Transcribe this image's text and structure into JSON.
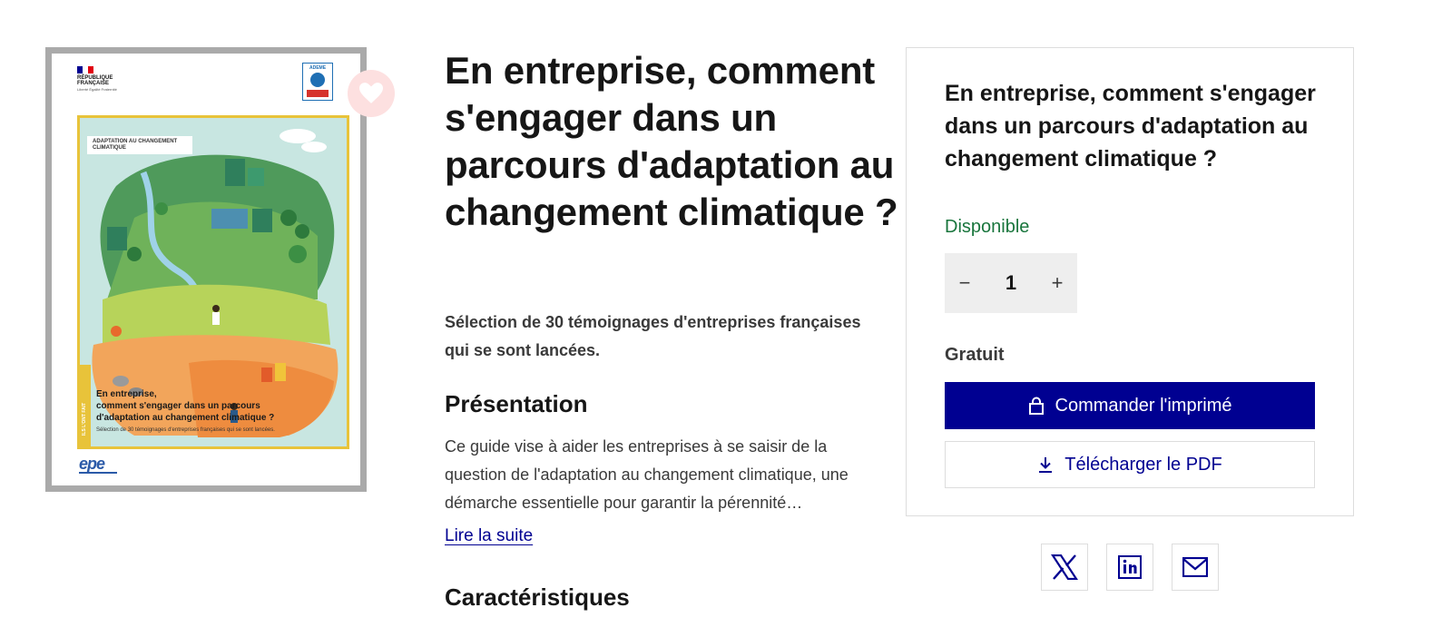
{
  "cover": {
    "republic_label": "RÉPUBLIQUE FRANÇAISE",
    "republic_motto": "Liberté Égalité Fraternité",
    "ademe_label": "ADEME",
    "tag": "ADAPTATION AU CHANGEMENT CLIMATIQUE",
    "side_band": "ILS L'ONT FAIT",
    "title_line1": "En entreprise,",
    "title_line2": "comment s'engager dans un parcours",
    "title_line3": "d'adaptation au changement climatique ?",
    "subtitle": "Sélection de 30 témoignages d'entreprises françaises qui se sont lancées.",
    "publisher_logo": "epe"
  },
  "favorite": {
    "icon": "heart-icon"
  },
  "product": {
    "title": "En entreprise, comment s'engager dans un parcours d'adaptation au changement climatique ?",
    "lead": "Sélection de 30 témoignages d'entreprises françaises qui se sont lancées.",
    "presentation_heading": "Présentation",
    "presentation_text": "Ce guide vise à aider les entreprises à se saisir de la question de l'adaptation au changement climatique, une démarche essentielle pour garantir la pérennité…",
    "read_more": "Lire la suite",
    "features_heading": "Caractéristiques"
  },
  "order": {
    "title": "En entreprise, comment s'engager dans un parcours d'adaptation au changement climatique ?",
    "availability": "Disponible",
    "quantity": "1",
    "decrement_symbol": "−",
    "increment_symbol": "+",
    "price": "Gratuit",
    "order_button": "Commander l'imprimé",
    "download_button": "Télécharger le PDF"
  },
  "share": {
    "icons": [
      "x-twitter-icon",
      "linkedin-icon",
      "mail-icon"
    ]
  },
  "colors": {
    "primary": "#000091",
    "available": "#18753c",
    "favorite_bg": "#fde0e0",
    "favorite_icon": "#ffffff",
    "cover_border": "#aaaaaa"
  }
}
